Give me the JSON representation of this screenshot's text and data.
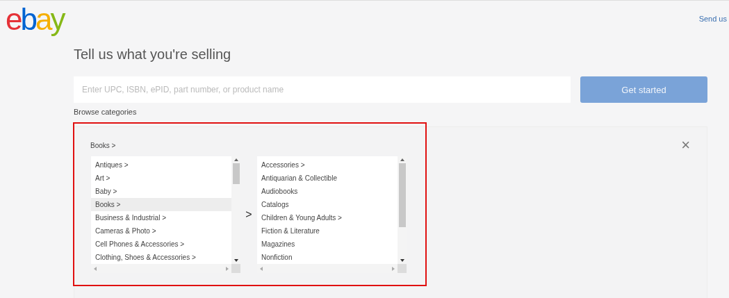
{
  "logo": "ebay",
  "feedback_link": "Send us",
  "heading": "Tell us what you're selling",
  "search": {
    "placeholder": "Enter UPC, ISBN, ePID, part number, or product name"
  },
  "get_started_button": "Get started",
  "browse_label": "Browse categories",
  "category_panel": {
    "breadcrumb": "Books >",
    "close": "×",
    "separator": ">",
    "lists": [
      {
        "items": [
          {
            "label": "Antiques >",
            "selected": false
          },
          {
            "label": "Art >",
            "selected": false
          },
          {
            "label": "Baby >",
            "selected": false
          },
          {
            "label": "Books >",
            "selected": true
          },
          {
            "label": "Business & Industrial >",
            "selected": false
          },
          {
            "label": "Cameras & Photo >",
            "selected": false
          },
          {
            "label": "Cell Phones & Accessories >",
            "selected": false
          },
          {
            "label": "Clothing, Shoes & Accessories >",
            "selected": false
          }
        ]
      },
      {
        "items": [
          {
            "label": "Accessories >",
            "selected": false
          },
          {
            "label": "Antiquarian & Collectible",
            "selected": false
          },
          {
            "label": "Audiobooks",
            "selected": false
          },
          {
            "label": "Catalogs",
            "selected": false
          },
          {
            "label": "Children & Young Adults >",
            "selected": false
          },
          {
            "label": "Fiction & Literature",
            "selected": false
          },
          {
            "label": "Magazines",
            "selected": false
          },
          {
            "label": "Nonfiction",
            "selected": false
          }
        ]
      }
    ]
  }
}
